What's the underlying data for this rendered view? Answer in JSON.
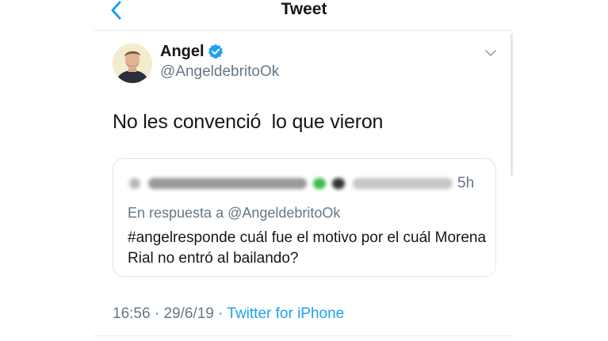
{
  "header": {
    "title": "Tweet",
    "back_icon": "chevron-left-icon",
    "accent_color": "#1da1f2"
  },
  "tweet": {
    "author_name": "Angel",
    "author_handle": "@AngeldebritoOk",
    "verified_icon": "verified-badge-icon",
    "menu_icon": "chevron-down-icon",
    "text": "No les convenció  lo que vieron",
    "time": "16:56",
    "date": "29/6/19",
    "separator": "·",
    "client": "Twitter for iPhone"
  },
  "quoted_tweet": {
    "time": "5h",
    "reply_to": "En respuesta a @AngeldebritoOk",
    "text": "#angelresponde cuál fue el motivo por el cuál Morena Rial no entró al bailando?"
  }
}
